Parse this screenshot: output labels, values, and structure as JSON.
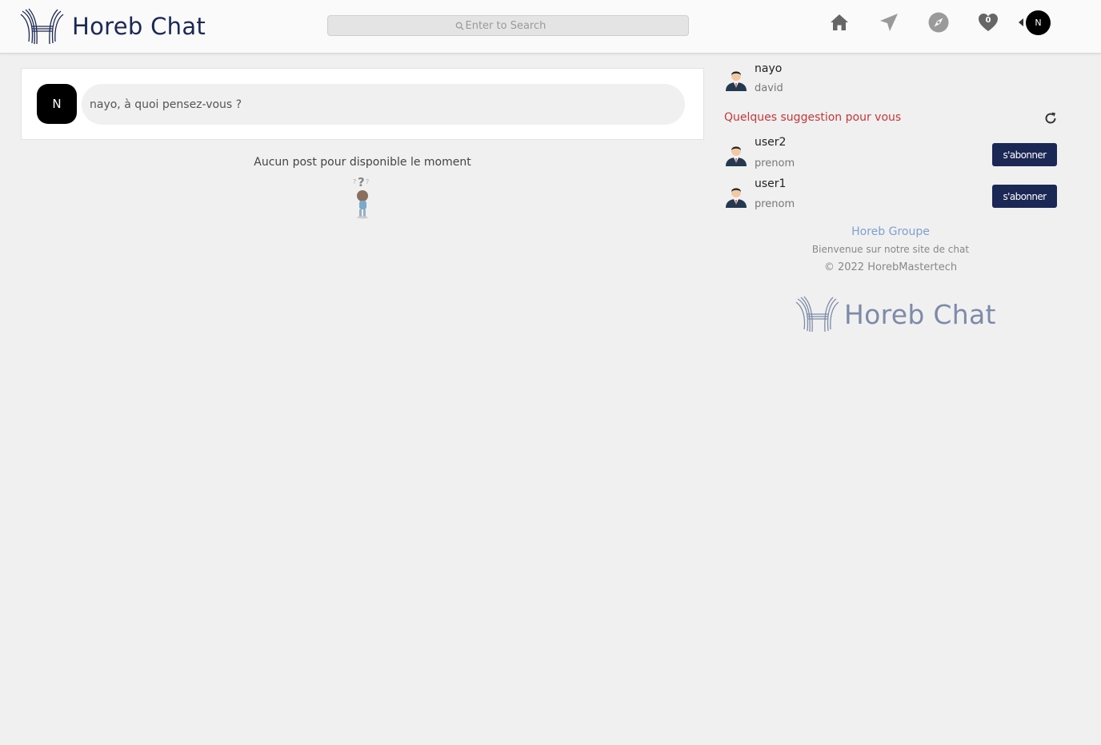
{
  "header": {
    "brand": "Horeb Chat",
    "search_placeholder": "Enter to Search",
    "notifications_count": "0",
    "avatar_initial": "N"
  },
  "composer": {
    "avatar_initial": "N",
    "prompt": "nayo, à quoi pensez-vous ?"
  },
  "feed": {
    "empty_message": "Aucun post pour disponible le moment"
  },
  "profile": {
    "username": "nayo",
    "subtitle": "david"
  },
  "suggestions": {
    "title": "Quelques suggestion pour vous",
    "items": [
      {
        "username": "user2",
        "subtitle": "prenom",
        "button": "s'abonner"
      },
      {
        "username": "user1",
        "subtitle": "prenom",
        "button": "s'abonner"
      }
    ]
  },
  "footer": {
    "group": "Horeb Groupe",
    "welcome": "Bienvenue sur notre site de chat",
    "copyright": "© 2022 HorebMastertech",
    "brand": "Horeb Chat"
  },
  "colors": {
    "brand": "#1b2855",
    "suggest_title": "#c8373b",
    "footer_link": "#7f9fcc"
  }
}
